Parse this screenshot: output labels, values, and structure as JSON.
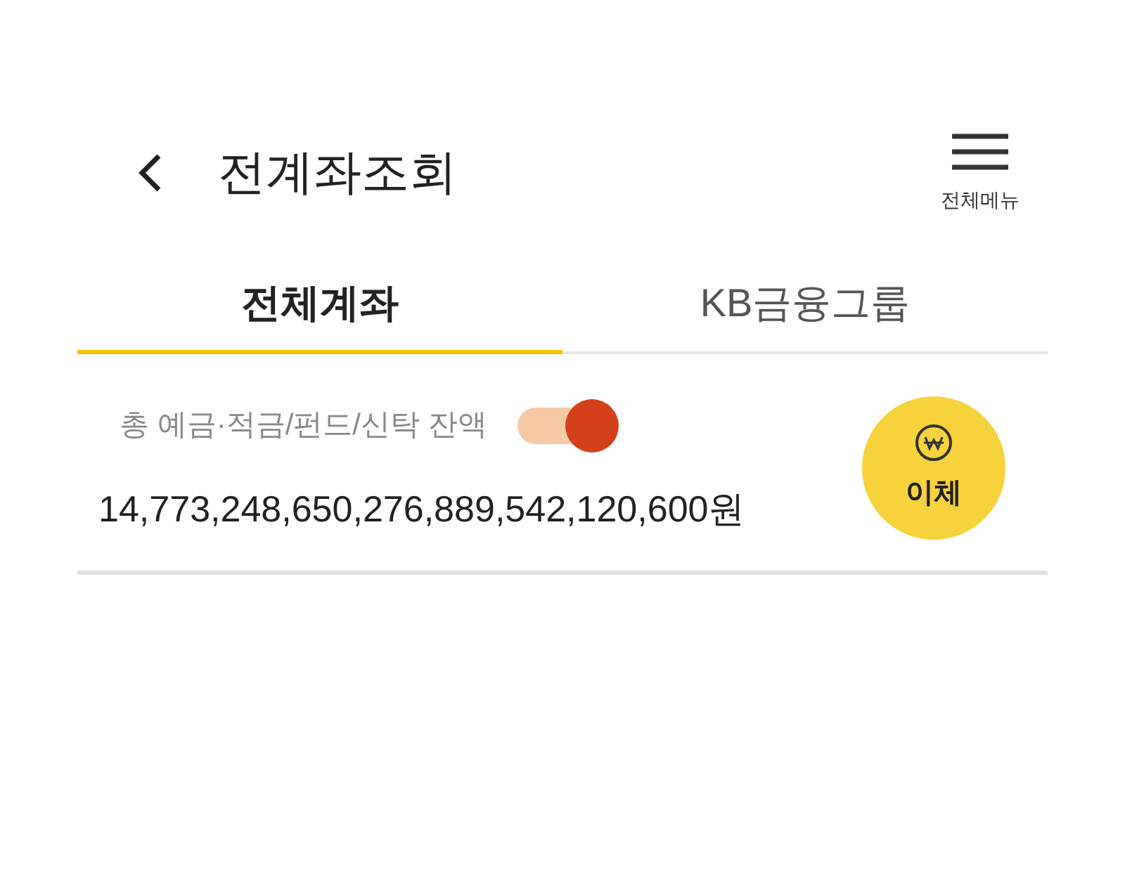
{
  "header": {
    "title": "전계좌조회",
    "menu_label": "전체메뉴"
  },
  "tabs": [
    {
      "label": "전체계좌",
      "selected": true
    },
    {
      "label": "KB금융그룹",
      "selected": false
    }
  ],
  "balance": {
    "label": "총 예금·적금/펀드/신탁 잔액",
    "toggle_on": true,
    "amount": "14,773,248,650,276,889,542,120,600원"
  },
  "transfer_button": {
    "label": "이체"
  }
}
